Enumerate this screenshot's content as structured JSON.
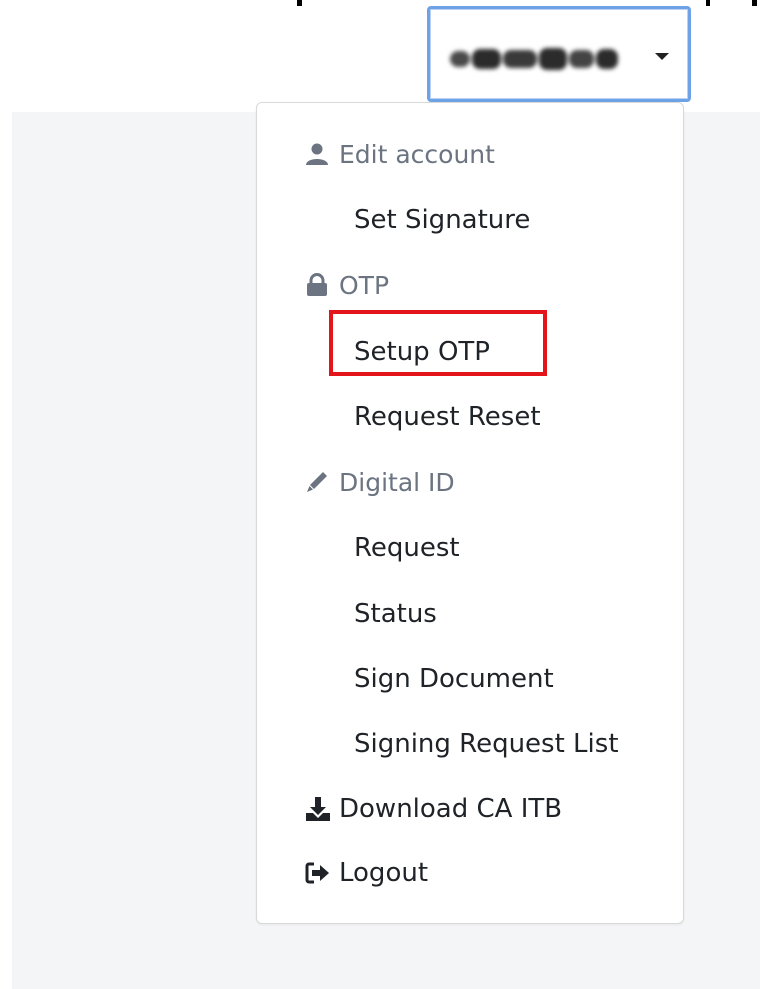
{
  "user_menu": {
    "username_redacted": true,
    "caret_icon": "caret-down-icon"
  },
  "dropdown": {
    "edit_account": {
      "icon": "user-icon",
      "label": "Edit account"
    },
    "set_signature": {
      "label": "Set Signature"
    },
    "otp": {
      "icon": "lock-icon",
      "label": "OTP"
    },
    "setup_otp": {
      "label": "Setup OTP"
    },
    "request_reset": {
      "label": "Request Reset"
    },
    "digital_id": {
      "icon": "pen-icon",
      "label": "Digital ID"
    },
    "request": {
      "label": "Request"
    },
    "status": {
      "label": "Status"
    },
    "sign_document": {
      "label": "Sign Document"
    },
    "signing_request_list": {
      "label": "Signing Request List"
    },
    "download_ca": {
      "icon": "download-icon",
      "label": "Download CA ITB"
    },
    "logout": {
      "icon": "logout-icon",
      "label": "Logout"
    }
  },
  "annotation": {
    "highlight_color": "#e4141b",
    "highlighted_item": "Setup OTP"
  },
  "colors": {
    "toggle_border": "#6ea2e6",
    "header_text": "#6b7480",
    "item_text": "#1f2328",
    "content_background": "#f4f5f7"
  }
}
